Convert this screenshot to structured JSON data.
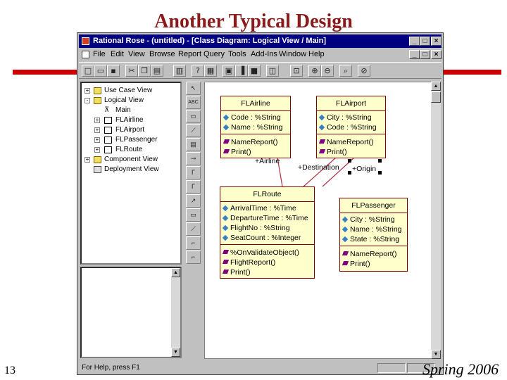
{
  "slide": {
    "title": "Another Typical Design",
    "number": "13",
    "footer": "Spring 2006"
  },
  "window": {
    "title": "Rational Rose - (untitled) - [Class Diagram: Logical View / Main]",
    "controls": [
      "_",
      "□",
      "×"
    ],
    "doc_controls": [
      "_",
      "□",
      "×"
    ]
  },
  "menu": [
    "File",
    "Edit",
    "View",
    "Browse",
    "Report",
    "Query",
    "Tools",
    "Add-Ins",
    "Window",
    "Help"
  ],
  "toolbar": [
    {
      "icon": "new-file-icon",
      "glyph": "□"
    },
    {
      "icon": "open-folder-icon",
      "glyph": "▭"
    },
    {
      "icon": "save-icon",
      "glyph": "▪"
    },
    {
      "icon": "cut-icon",
      "glyph": "✂"
    },
    {
      "icon": "copy-icon",
      "glyph": "❐"
    },
    {
      "icon": "paste-icon",
      "glyph": "▤"
    },
    {
      "icon": "print-icon",
      "glyph": "▥"
    },
    {
      "icon": "context-help-icon",
      "glyph": "?"
    },
    {
      "icon": "browse-icon",
      "glyph": "▦"
    },
    {
      "icon": "class-diagram-icon",
      "glyph": "▣"
    },
    {
      "icon": "interaction-diagram-icon",
      "glyph": "▐"
    },
    {
      "icon": "component-diagram-icon",
      "glyph": "■"
    },
    {
      "icon": "deployment-diagram-icon",
      "glyph": "◫"
    },
    {
      "icon": "parent-icon",
      "glyph": "⊡"
    },
    {
      "icon": "zoom-in-icon",
      "glyph": "⊕"
    },
    {
      "icon": "zoom-out-icon",
      "glyph": "⊖"
    },
    {
      "icon": "fit-window-icon",
      "glyph": "⌕"
    },
    {
      "icon": "undo-fit-icon",
      "glyph": "⊘"
    }
  ],
  "tree": [
    {
      "label": "Use Case View",
      "level": 0,
      "expander": "+",
      "icon": "folder"
    },
    {
      "label": "Logical View",
      "level": 0,
      "expander": "-",
      "icon": "folder"
    },
    {
      "label": "Main",
      "level": 1,
      "expander": "",
      "icon": "diagram"
    },
    {
      "label": "FLAirline",
      "level": 1,
      "expander": "+",
      "icon": "class"
    },
    {
      "label": "FLAirport",
      "level": 1,
      "expander": "+",
      "icon": "class"
    },
    {
      "label": "FLPassenger",
      "level": 1,
      "expander": "+",
      "icon": "class"
    },
    {
      "label": "FLRoute",
      "level": 1,
      "expander": "+",
      "icon": "class"
    },
    {
      "label": "Component View",
      "level": 0,
      "expander": "+",
      "icon": "folder"
    },
    {
      "label": "Deployment View",
      "level": 0,
      "expander": "",
      "icon": "node"
    }
  ],
  "palette": [
    "↖",
    "ABC",
    "▭",
    "⟋",
    "▤",
    "⊸",
    "Γ",
    "Γ",
    "↗",
    "▭",
    "⟋",
    "⌐",
    "⌐"
  ],
  "classes": [
    {
      "name": "FLAirline",
      "attributes": [
        "Code : %String",
        "Name : %String"
      ],
      "operations": [
        "NameReport()",
        "Print()"
      ]
    },
    {
      "name": "FLAirport",
      "attributes": [
        "City : %String",
        "Code : %String"
      ],
      "operations": [
        "NameReport()",
        "Print()"
      ]
    },
    {
      "name": "FLRoute",
      "attributes": [
        "ArrivalTime : %Time",
        "DepartureTime : %Time",
        "FlightNo : %String",
        "SeatCount : %Integer"
      ],
      "operations": [
        "%OnValidateObject()",
        "FlightReport()",
        "Print()"
      ]
    },
    {
      "name": "FLPassenger",
      "attributes": [
        "City : %String",
        "Name : %String",
        "State : %String"
      ],
      "operations": [
        "NameReport()",
        "Print()"
      ]
    }
  ],
  "roles": {
    "airline": "+Airline",
    "destination": "+Destination",
    "origin": "+Origin"
  },
  "colors": {
    "title": "#8b1a1a",
    "rule": "#cc0000",
    "class_fill": "#ffffcc",
    "class_border": "#800000",
    "link": "#b03040"
  },
  "status": "For Help, press F1"
}
